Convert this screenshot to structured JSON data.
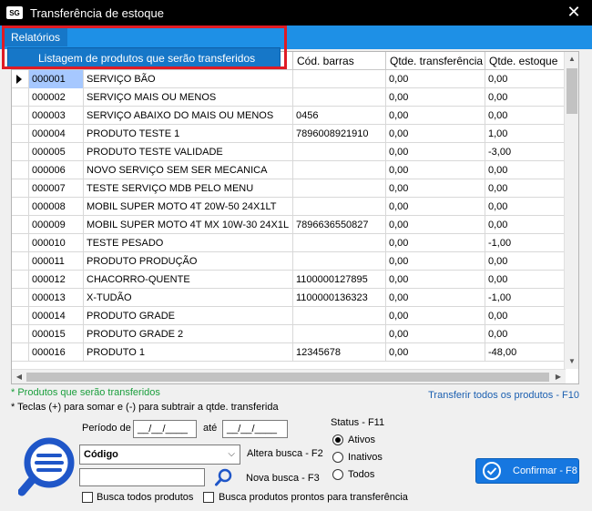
{
  "window": {
    "title": "Transferência de estoque",
    "app_badge": "SG"
  },
  "menu": {
    "relatorios": "Relatórios",
    "dropdown_item": "Listagem de produtos que serão transferidos"
  },
  "grid": {
    "columns": [
      "",
      "",
      "",
      "Cód. barras",
      "Qtde. transferência",
      "Qtde. estoque"
    ],
    "rows": [
      [
        "000001",
        "SERVIÇO BÃO",
        "",
        "0,00",
        "0,00"
      ],
      [
        "000002",
        "SERVIÇO MAIS OU MENOS",
        "",
        "0,00",
        "0,00"
      ],
      [
        "000003",
        "SERVIÇO ABAIXO DO MAIS OU MENOS",
        "0456",
        "0,00",
        "0,00"
      ],
      [
        "000004",
        "PRODUTO TESTE 1",
        "7896008921910",
        "0,00",
        "1,00"
      ],
      [
        "000005",
        "PRODUTO TESTE VALIDADE",
        "",
        "0,00",
        "-3,00"
      ],
      [
        "000006",
        "NOVO SERVIÇO SEM SER MECANICA",
        "",
        "0,00",
        "0,00"
      ],
      [
        "000007",
        "TESTE SERVIÇO MDB PELO MENU",
        "",
        "0,00",
        "0,00"
      ],
      [
        "000008",
        "MOBIL SUPER MOTO 4T 20W-50 24X1LT",
        "",
        "0,00",
        "0,00"
      ],
      [
        "000009",
        "MOBIL SUPER MOTO 4T MX 10W-30 24X1L",
        "7896636550827",
        "0,00",
        "0,00"
      ],
      [
        "000010",
        "TESTE PESADO",
        "",
        "0,00",
        "-1,00"
      ],
      [
        "000011",
        "PRODUTO PRODUÇÃO",
        "",
        "0,00",
        "0,00"
      ],
      [
        "000012",
        "CHACORRO-QUENTE",
        "1100000127895",
        "0,00",
        "0,00"
      ],
      [
        "000013",
        "X-TUDÃO",
        "1100000136323",
        "0,00",
        "-1,00"
      ],
      [
        "000014",
        "PRODUTO GRADE",
        "",
        "0,00",
        "0,00"
      ],
      [
        "000015",
        "PRODUTO GRADE 2",
        "",
        "0,00",
        "0,00"
      ],
      [
        "000016",
        "PRODUTO 1",
        "12345678",
        "0,00",
        "-48,00"
      ]
    ]
  },
  "notes": {
    "green": "* Produtos que serão transferidos",
    "black": "* Teclas (+) para somar e (-) para subtrair a qtde. transferida",
    "transfer_all": "Transferir todos os produtos - F10"
  },
  "filters": {
    "periodo_label": "Período de",
    "ate_label": "até",
    "date_from": "__/__/____",
    "date_to": "__/__/____",
    "search_field": "Código",
    "altera_busca": "Altera busca - F2",
    "nova_busca": "Nova busca - F3",
    "busca_todos": "Busca todos produtos",
    "busca_prontos": "Busca produtos prontos para transferência"
  },
  "status": {
    "title": "Status - F11",
    "options": [
      "Ativos",
      "Inativos",
      "Todos"
    ],
    "selected": "Ativos"
  },
  "confirm": {
    "label": "Confirmar - F8"
  },
  "colors": {
    "menubar": "#1e90e6",
    "dropdown": "#1677c8",
    "highlight": "#e01b24",
    "note_green": "#1a9e3c",
    "link_blue": "#1b5fb0",
    "confirm": "#1677e0"
  }
}
